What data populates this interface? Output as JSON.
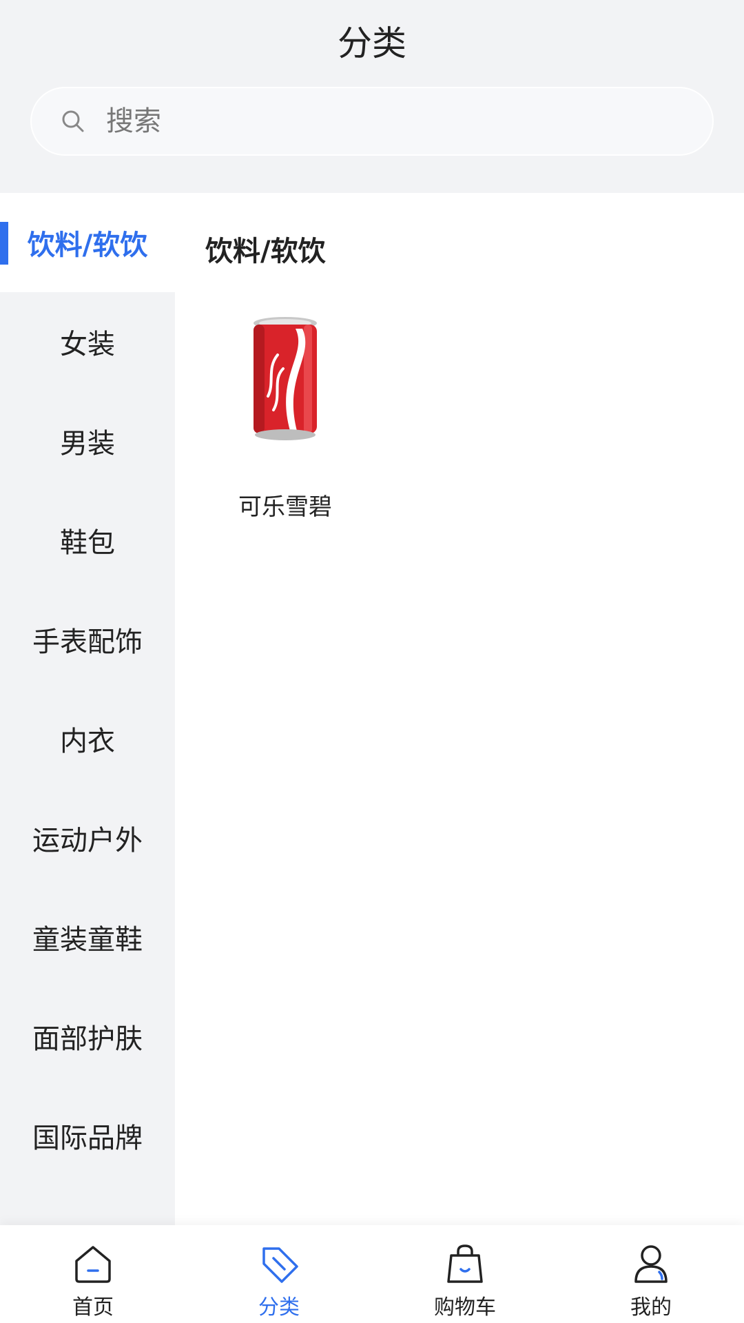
{
  "header": {
    "title": "分类",
    "search": {
      "placeholder": "搜索",
      "value": ""
    }
  },
  "sidebar": {
    "items": [
      {
        "label": "饮料/软饮",
        "active": true
      },
      {
        "label": "女装"
      },
      {
        "label": "男装"
      },
      {
        "label": "鞋包"
      },
      {
        "label": "手表配饰"
      },
      {
        "label": "内衣"
      },
      {
        "label": "运动户外"
      },
      {
        "label": "童装童鞋"
      },
      {
        "label": "面部护肤"
      },
      {
        "label": "国际品牌"
      }
    ]
  },
  "content": {
    "section_title": "饮料/软饮",
    "products": [
      {
        "name": "可乐雪碧",
        "image": "cola-can-image"
      }
    ]
  },
  "tabbar": {
    "tabs": [
      {
        "label": "首页",
        "icon": "home-icon"
      },
      {
        "label": "分类",
        "icon": "tag-icon",
        "active": true
      },
      {
        "label": "购物车",
        "icon": "shopping-bag-icon"
      },
      {
        "label": "我的",
        "icon": "user-icon"
      }
    ]
  },
  "colors": {
    "accent": "#2f6fed",
    "header_bg": "#f2f3f5",
    "sidebar_bg": "#f2f3f5",
    "cola_red": "#d9232a"
  }
}
